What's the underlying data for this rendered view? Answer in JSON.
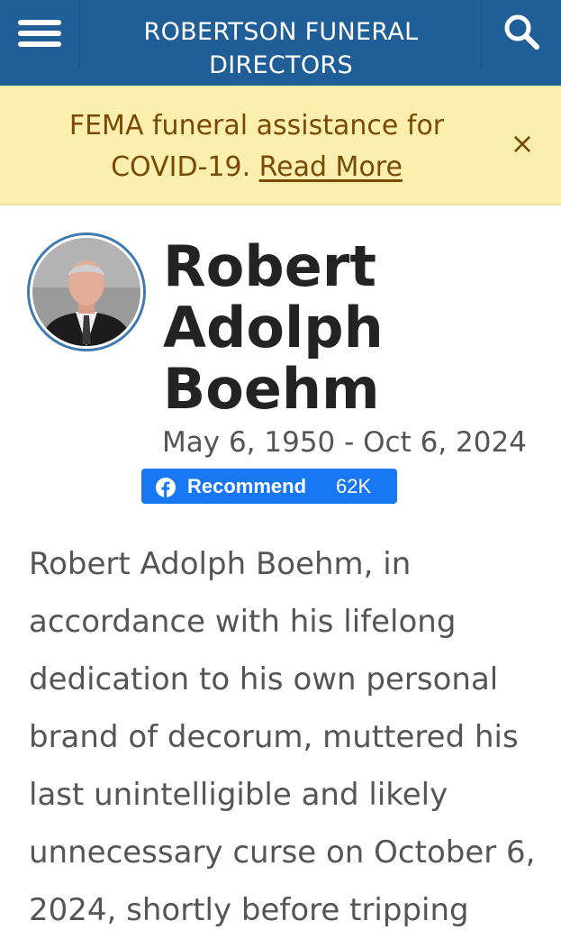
{
  "header": {
    "site_title": "ROBERTSON FUNERAL DIRECTORS",
    "menu_icon": "hamburger-icon",
    "search_icon": "search-icon",
    "color": "#1f5e96"
  },
  "banner": {
    "text": "FEMA funeral assistance for COVID-19. ",
    "link_label": "Read More",
    "close_label": "×",
    "background": "#fbefb0",
    "text_color": "#7a4a05"
  },
  "profile": {
    "name_lines": [
      "Robert",
      "Adolph",
      "Boehm"
    ],
    "dates": "May 6, 1950 - Oct 6, 2024",
    "recommend": {
      "label": "Recommend",
      "count": "62K",
      "icon": "facebook-icon",
      "color": "#1877f2"
    }
  },
  "obituary": {
    "text": "Robert Adolph Boehm, in accordance with his lifelong dedication to his own personal brand of decorum, muttered his last unintelligible and likely unnecessary curse on October 6, 2024, shortly before tripping"
  }
}
